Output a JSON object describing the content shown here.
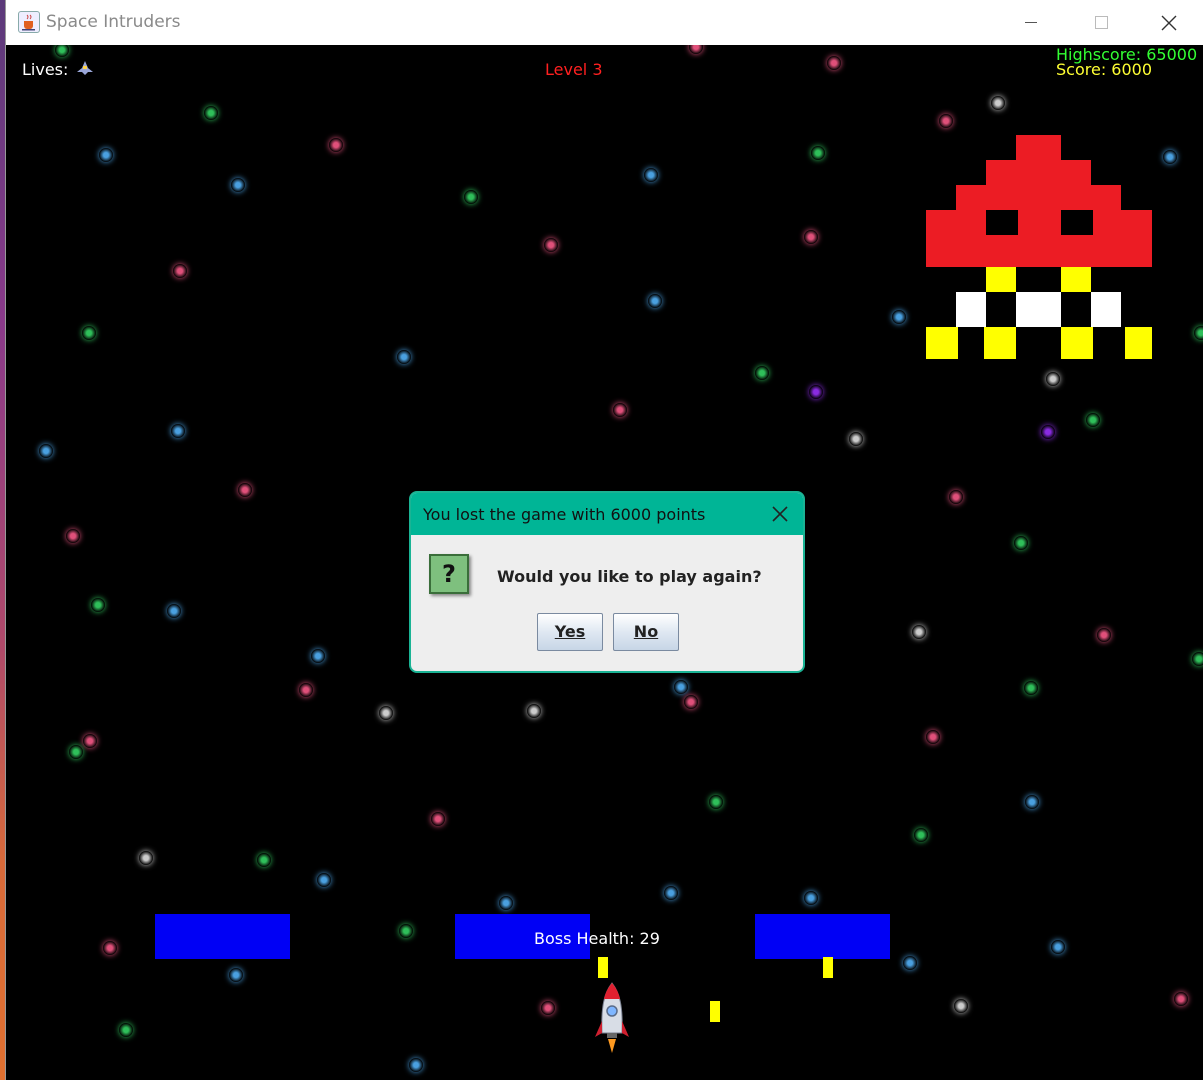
{
  "window": {
    "title": "Space Intruders"
  },
  "hud": {
    "lives_label": "Lives:",
    "level": "Level 3",
    "highscore": "Highscore: 65000",
    "score": "Score: 6000",
    "boss_health": "Boss Health: 29"
  },
  "dialog": {
    "title": "You lost the game with 6000 points",
    "message": "Would you like to play again?",
    "icon_glyph": "?",
    "yes_label": "Yes",
    "no_label": "No"
  },
  "colors": {
    "background": "#000000",
    "hud_label": "#ffffff",
    "level": "#ff2020",
    "highscore": "#33ff33",
    "score": "#ffff33",
    "bunker": "#0000f5",
    "bullet": "#ffff00",
    "boss_red": "#ec1c24",
    "boss_yellow": "#ffff00",
    "dialog_title_bar": "#00b596"
  },
  "icons": {
    "app": "java-cup-icon",
    "minimize": "minimize-icon",
    "maximize": "maximize-icon",
    "close": "close-icon",
    "life": "ship-icon",
    "player": "rocket-icon",
    "dialog_question": "question-icon"
  }
}
